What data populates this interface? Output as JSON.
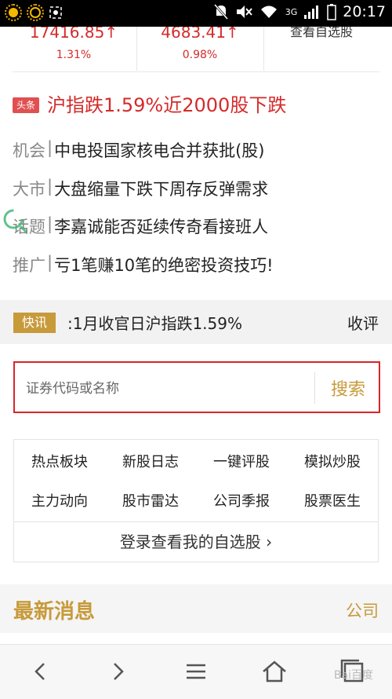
{
  "status_bar": {
    "time": "20:17",
    "network": "3G",
    "icons": [
      "brightness-icon",
      "brightness-auto-icon",
      "screenshot-icon",
      "mute-icon",
      "volume-off-icon",
      "wifi-icon",
      "signal-icon",
      "battery-icon"
    ]
  },
  "indices": [
    {
      "value": "17416.85↑",
      "change": "1.31%"
    },
    {
      "value": "4683.41↑",
      "change": "0.98%"
    }
  ],
  "watchlist_link": "查看自选股",
  "headline": {
    "tag": "头条",
    "text": "沪指跌1.59%近2000股下跌"
  },
  "news": [
    {
      "category": "机会",
      "title": "中电投国家核电合并获批(股)"
    },
    {
      "category": "大市",
      "title": "大盘缩量下跌下周存反弹需求"
    },
    {
      "category": "话题",
      "title": "李嘉诚能否延续传奇看接班人"
    },
    {
      "category": "推广",
      "title": "亏1笔赚10笔的绝密投资技巧!"
    }
  ],
  "flash": {
    "tag": "快讯",
    "text": ":1月收官日沪指跌1.59%",
    "tail": "收评"
  },
  "search": {
    "placeholder": "证券代码或名称",
    "button": "搜索"
  },
  "tools": [
    "热点板块",
    "新股日志",
    "一键评股",
    "模拟炒股",
    "主力动向",
    "股市雷达",
    "公司季报",
    "股票医生"
  ],
  "login_link": "登录查看我的自选股 ›",
  "latest": {
    "title": "最新消息",
    "right": "公司"
  },
  "watermark": "Bai百度"
}
